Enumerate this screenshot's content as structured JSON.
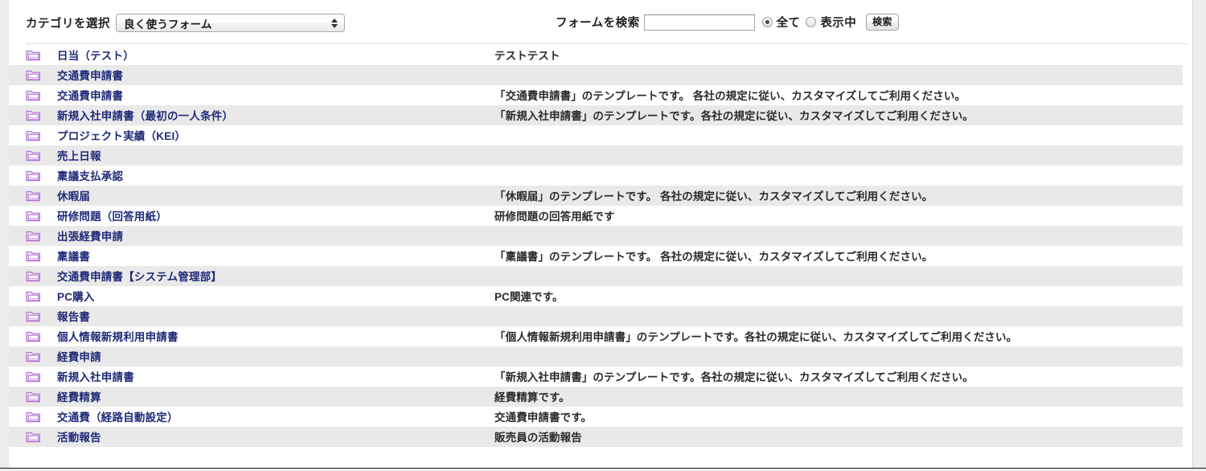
{
  "toolbar": {
    "category_label": "カテゴリを選択",
    "category_selected": "良く使うフォーム",
    "search_label": "フォームを検索",
    "search_value": "",
    "search_placeholder": "",
    "radio_all_label": "全て",
    "radio_visible_label": "表示中",
    "radio_selected": "全て",
    "search_button_label": "検索"
  },
  "colors": {
    "link": "#1f2a78",
    "row_alt": "#e9e9e9",
    "page_bg": "#ececec",
    "panel_bg": "#ffffff",
    "folder_icon": "#c18fd8"
  },
  "list": {
    "icon_name": "folder-icon",
    "rows": [
      {
        "name": "日当（テスト）",
        "desc": "テストテスト"
      },
      {
        "name": "交通費申請書",
        "desc": ""
      },
      {
        "name": "交通費申請書",
        "desc": "「交通費申請書」のテンプレートです。 各社の規定に従い、カスタマイズしてご利用ください。"
      },
      {
        "name": "新規入社申請書（最初の一人条件）",
        "desc": "「新規入社申請書」のテンプレートです。各社の規定に従い、カスタマイズしてご利用ください。"
      },
      {
        "name": "プロジェクト実績（KEI）",
        "desc": ""
      },
      {
        "name": "売上日報",
        "desc": ""
      },
      {
        "name": "稟議支払承認",
        "desc": ""
      },
      {
        "name": "休暇届",
        "desc": "「休暇届」のテンプレートです。 各社の規定に従い、カスタマイズしてご利用ください。"
      },
      {
        "name": "研修問題（回答用紙）",
        "desc": "研修問題の回答用紙です"
      },
      {
        "name": "出張経費申請",
        "desc": ""
      },
      {
        "name": "稟議書",
        "desc": "「稟議書」のテンプレートです。 各社の規定に従い、カスタマイズしてご利用ください。"
      },
      {
        "name": "交通費申請書【システム管理部】",
        "desc": ""
      },
      {
        "name": "PC購入",
        "desc": "PC関連です。"
      },
      {
        "name": "報告書",
        "desc": ""
      },
      {
        "name": "個人情報新規利用申請書",
        "desc": "「個人情報新規利用申請書」のテンプレートです。各社の規定に従い、カスタマイズしてご利用ください。"
      },
      {
        "name": "経費申請",
        "desc": ""
      },
      {
        "name": "新規入社申請書",
        "desc": "「新規入社申請書」のテンプレートです。各社の規定に従い、カスタマイズしてご利用ください。"
      },
      {
        "name": "経費精算",
        "desc": "経費精算です。"
      },
      {
        "name": "交通費（経路自動設定）",
        "desc": "交通費申請書です。"
      },
      {
        "name": "活動報告",
        "desc": "販売員の活動報告"
      }
    ]
  }
}
